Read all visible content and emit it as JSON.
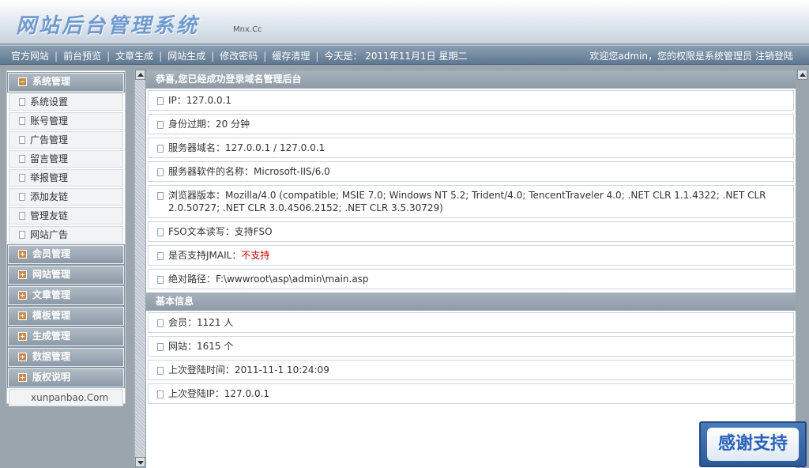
{
  "header": {
    "logo": "网站后台管理系统",
    "domain": "Mnx.Cc"
  },
  "nav": {
    "links": [
      "官方网站",
      "前台预览",
      "文章生成",
      "网站生成",
      "修改密码",
      "缓存清理"
    ],
    "date_label": "今天是：",
    "date_value": "2011年11月1日 星期二",
    "welcome": "欢迎您admin，您的权限是系统管理员",
    "logout": "注销登陆"
  },
  "sidebar": {
    "open_section": "系统管理",
    "items": [
      "系统设置",
      "账号管理",
      "广告管理",
      "留言管理",
      "举报管理",
      "添加友链",
      "管理友链",
      "网站广告"
    ],
    "sections": [
      "会员管理",
      "网站管理",
      "文章管理",
      "模板管理",
      "生成管理",
      "数据管理",
      "版权说明"
    ],
    "footer": "xunpanbao.Com"
  },
  "main": {
    "welcome_title": "恭喜,您已经成功登录域名管理后台",
    "server_info": [
      {
        "label": "IP：",
        "value": "127.0.0.1"
      },
      {
        "label": "身份过期：",
        "value": "20 分钟"
      },
      {
        "label": "服务器域名：",
        "value": "127.0.0.1 / 127.0.0.1"
      },
      {
        "label": "服务器软件的名称：",
        "value": "Microsoft-IIS/6.0"
      },
      {
        "label": "浏览器版本：",
        "value": "Mozilla/4.0 (compatible; MSIE 7.0; Windows NT 5.2; Trident/4.0; TencentTraveler 4.0; .NET CLR 1.1.4322; .NET CLR 2.0.50727; .NET CLR 3.0.4506.2152; .NET CLR 3.5.30729)"
      },
      {
        "label": "FSO文本读写：",
        "value": "支持FSO"
      },
      {
        "label": "是否支持JMAIL：",
        "value": "不支持"
      },
      {
        "label": "绝对路径：",
        "value": "F:\\wwwroot\\asp\\admin\\main.asp"
      }
    ],
    "basic_title": "基本信息",
    "basic_info": [
      {
        "label": "会员：",
        "value": "1121 人"
      },
      {
        "label": "网站：",
        "value": "1615 个"
      },
      {
        "label": "上次登陆时间：",
        "value": "2011-11-1 10:24:09"
      },
      {
        "label": "上次登陆IP：",
        "value": "127.0.0.1"
      }
    ]
  },
  "thanks_button": "感谢支持",
  "colors": {
    "accent": "#8e9ba7",
    "warning_text": "#cc0000",
    "nav_bg": "#5f7890"
  }
}
